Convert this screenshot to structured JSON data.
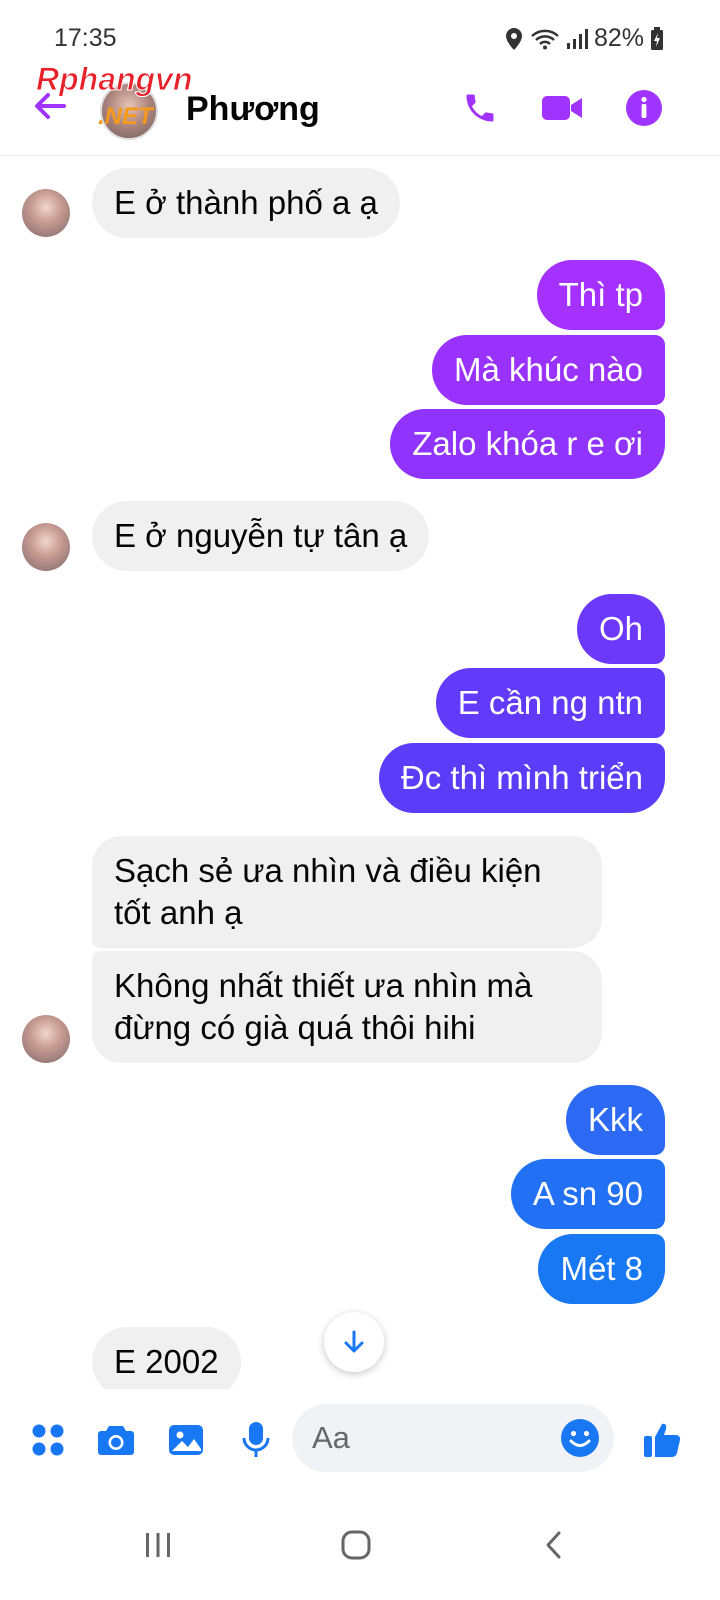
{
  "status": {
    "time": "17:35",
    "battery": "82%"
  },
  "header": {
    "contact_name": "Phương",
    "watermark": {
      "line1": "Rphangvn",
      "line2": ".NET"
    }
  },
  "messages": [
    {
      "dir": "in",
      "text": "E ở thành phố a ạ"
    },
    {
      "dir": "out",
      "text": "Thì tp"
    },
    {
      "dir": "out",
      "text": "Mà khúc nào"
    },
    {
      "dir": "out",
      "text": "Zalo khóa r e ơi"
    },
    {
      "dir": "in",
      "text": "E ở nguyễn tự tân ạ"
    },
    {
      "dir": "out",
      "text": "Oh"
    },
    {
      "dir": "out",
      "text": "E cần ng ntn"
    },
    {
      "dir": "out",
      "text": "Đc thì mình triển"
    },
    {
      "dir": "in",
      "text": "Sạch sẻ ưa nhìn và điều kiện\ntốt anh ạ"
    },
    {
      "dir": "in",
      "text": "Không nhất thiết ưa nhìn mà\nđừng có già quá thôi hihi"
    },
    {
      "dir": "out",
      "text": "Kkk"
    },
    {
      "dir": "out",
      "text": "A sn 90"
    },
    {
      "dir": "out",
      "text": "Mét 8"
    },
    {
      "dir": "in",
      "text": "E 2002"
    }
  ],
  "composer": {
    "placeholder": "Aa"
  },
  "colors": {
    "accent": "#a033ff",
    "incoming_bg": "#f0f0f0",
    "gradient_top": "#a531ff",
    "gradient_mid": "#5f3cff",
    "gradient_bottom": "#1877f2"
  }
}
